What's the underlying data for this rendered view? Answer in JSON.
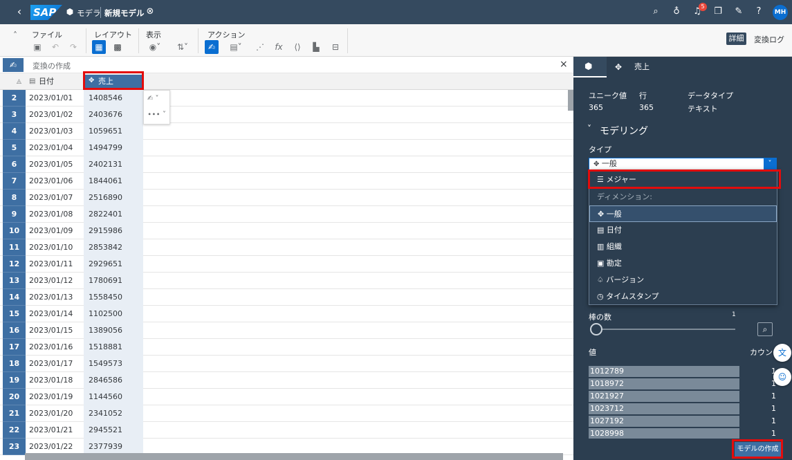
{
  "shell": {
    "logo": "SAP",
    "app": "モデラ",
    "title": "新規モデル",
    "notification_count": "5",
    "avatar": "MH"
  },
  "toolbar": {
    "file": "ファイル",
    "layout": "レイアウト",
    "display": "表示",
    "action": "アクション",
    "detail": "詳細",
    "changelog": "変換ログ"
  },
  "transform": {
    "label": "変換の作成",
    "close": "×"
  },
  "grid": {
    "headers": [
      "日付",
      "売上"
    ],
    "rows": [
      {
        "n": "2",
        "date": "2023/01/01",
        "sales": "1408546"
      },
      {
        "n": "3",
        "date": "2023/01/02",
        "sales": "2403676"
      },
      {
        "n": "4",
        "date": "2023/01/03",
        "sales": "1059651"
      },
      {
        "n": "5",
        "date": "2023/01/04",
        "sales": "1494799"
      },
      {
        "n": "6",
        "date": "2023/01/05",
        "sales": "2402131"
      },
      {
        "n": "7",
        "date": "2023/01/06",
        "sales": "1844061"
      },
      {
        "n": "8",
        "date": "2023/01/07",
        "sales": "2516890"
      },
      {
        "n": "9",
        "date": "2023/01/08",
        "sales": "2822401"
      },
      {
        "n": "10",
        "date": "2023/01/09",
        "sales": "2915986"
      },
      {
        "n": "11",
        "date": "2023/01/10",
        "sales": "2853842"
      },
      {
        "n": "12",
        "date": "2023/01/11",
        "sales": "2929651"
      },
      {
        "n": "13",
        "date": "2023/01/12",
        "sales": "1780691"
      },
      {
        "n": "14",
        "date": "2023/01/13",
        "sales": "1558450"
      },
      {
        "n": "15",
        "date": "2023/01/14",
        "sales": "1102500"
      },
      {
        "n": "16",
        "date": "2023/01/15",
        "sales": "1389056"
      },
      {
        "n": "17",
        "date": "2023/01/16",
        "sales": "1518881"
      },
      {
        "n": "18",
        "date": "2023/01/17",
        "sales": "1549573"
      },
      {
        "n": "19",
        "date": "2023/01/18",
        "sales": "2846586"
      },
      {
        "n": "20",
        "date": "2023/01/19",
        "sales": "1144560"
      },
      {
        "n": "21",
        "date": "2023/01/20",
        "sales": "2341052"
      },
      {
        "n": "22",
        "date": "2023/01/21",
        "sales": "2945521"
      },
      {
        "n": "23",
        "date": "2023/01/22",
        "sales": "2377939"
      }
    ]
  },
  "panel": {
    "tab_label": "売上",
    "unique_label": "ユニーク値",
    "unique_value": "365",
    "rows_label": "行",
    "rows_value": "365",
    "datatype_label": "データタイプ",
    "datatype_value": "テキスト",
    "modeling": "モデリング",
    "type_label": "タイプ",
    "type_value": "一般",
    "bins_label": "棒の数",
    "bins_value": "1",
    "value_label": "値",
    "count_label": "カウント",
    "values": [
      {
        "v": "1012789",
        "c": "1"
      },
      {
        "v": "1018972",
        "c": "1"
      },
      {
        "v": "1021927",
        "c": "1"
      },
      {
        "v": "1023712",
        "c": "1"
      },
      {
        "v": "1027192",
        "c": "1"
      },
      {
        "v": "1028998",
        "c": "1"
      }
    ],
    "create_model": "モデルの作成"
  },
  "dropdown": {
    "measure": "メジャー",
    "dimension_group": "ディメンション:",
    "general": "一般",
    "date": "日付",
    "org": "組織",
    "account": "勘定",
    "version": "バージョン",
    "timestamp": "タイムスタンプ"
  },
  "colors": {
    "shell": "#354a5f",
    "panel": "#2c3e50",
    "highlight": "#e30c0c",
    "rownum": "#3e6fa3"
  }
}
